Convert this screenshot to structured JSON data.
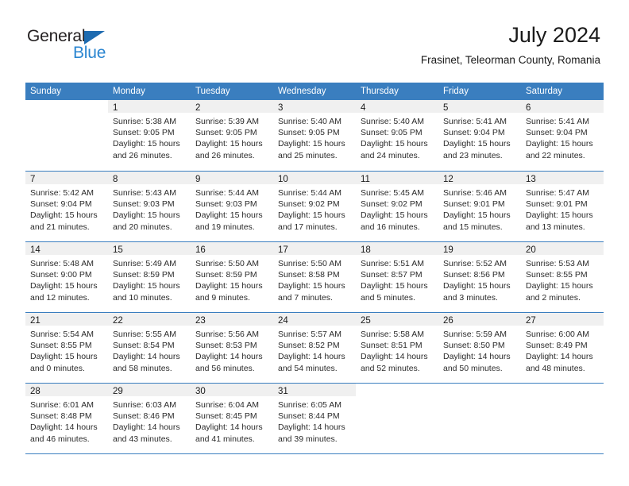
{
  "brand": {
    "name_top": "General",
    "name_bottom": "Blue",
    "triangle_color": "#1e6bb0",
    "blue_color": "#2a85d0"
  },
  "header": {
    "title": "July 2024",
    "subtitle": "Frasinet, Teleorman County, Romania"
  },
  "theme": {
    "header_blue": "#3a7ebf",
    "day_band_gray": "#f0f0f0",
    "text": "#1a1a1a"
  },
  "calendar": {
    "weekday_headers": [
      "Sunday",
      "Monday",
      "Tuesday",
      "Wednesday",
      "Thursday",
      "Friday",
      "Saturday"
    ],
    "weeks": [
      [
        {
          "day": "",
          "empty": true,
          "sunrise": "",
          "sunset": "",
          "daylight_1": "",
          "daylight_2": ""
        },
        {
          "day": "1",
          "sunrise": "Sunrise: 5:38 AM",
          "sunset": "Sunset: 9:05 PM",
          "daylight_1": "Daylight: 15 hours",
          "daylight_2": "and 26 minutes."
        },
        {
          "day": "2",
          "sunrise": "Sunrise: 5:39 AM",
          "sunset": "Sunset: 9:05 PM",
          "daylight_1": "Daylight: 15 hours",
          "daylight_2": "and 26 minutes."
        },
        {
          "day": "3",
          "sunrise": "Sunrise: 5:40 AM",
          "sunset": "Sunset: 9:05 PM",
          "daylight_1": "Daylight: 15 hours",
          "daylight_2": "and 25 minutes."
        },
        {
          "day": "4",
          "sunrise": "Sunrise: 5:40 AM",
          "sunset": "Sunset: 9:05 PM",
          "daylight_1": "Daylight: 15 hours",
          "daylight_2": "and 24 minutes."
        },
        {
          "day": "5",
          "sunrise": "Sunrise: 5:41 AM",
          "sunset": "Sunset: 9:04 PM",
          "daylight_1": "Daylight: 15 hours",
          "daylight_2": "and 23 minutes."
        },
        {
          "day": "6",
          "sunrise": "Sunrise: 5:41 AM",
          "sunset": "Sunset: 9:04 PM",
          "daylight_1": "Daylight: 15 hours",
          "daylight_2": "and 22 minutes."
        }
      ],
      [
        {
          "day": "7",
          "sunrise": "Sunrise: 5:42 AM",
          "sunset": "Sunset: 9:04 PM",
          "daylight_1": "Daylight: 15 hours",
          "daylight_2": "and 21 minutes."
        },
        {
          "day": "8",
          "sunrise": "Sunrise: 5:43 AM",
          "sunset": "Sunset: 9:03 PM",
          "daylight_1": "Daylight: 15 hours",
          "daylight_2": "and 20 minutes."
        },
        {
          "day": "9",
          "sunrise": "Sunrise: 5:44 AM",
          "sunset": "Sunset: 9:03 PM",
          "daylight_1": "Daylight: 15 hours",
          "daylight_2": "and 19 minutes."
        },
        {
          "day": "10",
          "sunrise": "Sunrise: 5:44 AM",
          "sunset": "Sunset: 9:02 PM",
          "daylight_1": "Daylight: 15 hours",
          "daylight_2": "and 17 minutes."
        },
        {
          "day": "11",
          "sunrise": "Sunrise: 5:45 AM",
          "sunset": "Sunset: 9:02 PM",
          "daylight_1": "Daylight: 15 hours",
          "daylight_2": "and 16 minutes."
        },
        {
          "day": "12",
          "sunrise": "Sunrise: 5:46 AM",
          "sunset": "Sunset: 9:01 PM",
          "daylight_1": "Daylight: 15 hours",
          "daylight_2": "and 15 minutes."
        },
        {
          "day": "13",
          "sunrise": "Sunrise: 5:47 AM",
          "sunset": "Sunset: 9:01 PM",
          "daylight_1": "Daylight: 15 hours",
          "daylight_2": "and 13 minutes."
        }
      ],
      [
        {
          "day": "14",
          "sunrise": "Sunrise: 5:48 AM",
          "sunset": "Sunset: 9:00 PM",
          "daylight_1": "Daylight: 15 hours",
          "daylight_2": "and 12 minutes."
        },
        {
          "day": "15",
          "sunrise": "Sunrise: 5:49 AM",
          "sunset": "Sunset: 8:59 PM",
          "daylight_1": "Daylight: 15 hours",
          "daylight_2": "and 10 minutes."
        },
        {
          "day": "16",
          "sunrise": "Sunrise: 5:50 AM",
          "sunset": "Sunset: 8:59 PM",
          "daylight_1": "Daylight: 15 hours",
          "daylight_2": "and 9 minutes."
        },
        {
          "day": "17",
          "sunrise": "Sunrise: 5:50 AM",
          "sunset": "Sunset: 8:58 PM",
          "daylight_1": "Daylight: 15 hours",
          "daylight_2": "and 7 minutes."
        },
        {
          "day": "18",
          "sunrise": "Sunrise: 5:51 AM",
          "sunset": "Sunset: 8:57 PM",
          "daylight_1": "Daylight: 15 hours",
          "daylight_2": "and 5 minutes."
        },
        {
          "day": "19",
          "sunrise": "Sunrise: 5:52 AM",
          "sunset": "Sunset: 8:56 PM",
          "daylight_1": "Daylight: 15 hours",
          "daylight_2": "and 3 minutes."
        },
        {
          "day": "20",
          "sunrise": "Sunrise: 5:53 AM",
          "sunset": "Sunset: 8:55 PM",
          "daylight_1": "Daylight: 15 hours",
          "daylight_2": "and 2 minutes."
        }
      ],
      [
        {
          "day": "21",
          "sunrise": "Sunrise: 5:54 AM",
          "sunset": "Sunset: 8:55 PM",
          "daylight_1": "Daylight: 15 hours",
          "daylight_2": "and 0 minutes."
        },
        {
          "day": "22",
          "sunrise": "Sunrise: 5:55 AM",
          "sunset": "Sunset: 8:54 PM",
          "daylight_1": "Daylight: 14 hours",
          "daylight_2": "and 58 minutes."
        },
        {
          "day": "23",
          "sunrise": "Sunrise: 5:56 AM",
          "sunset": "Sunset: 8:53 PM",
          "daylight_1": "Daylight: 14 hours",
          "daylight_2": "and 56 minutes."
        },
        {
          "day": "24",
          "sunrise": "Sunrise: 5:57 AM",
          "sunset": "Sunset: 8:52 PM",
          "daylight_1": "Daylight: 14 hours",
          "daylight_2": "and 54 minutes."
        },
        {
          "day": "25",
          "sunrise": "Sunrise: 5:58 AM",
          "sunset": "Sunset: 8:51 PM",
          "daylight_1": "Daylight: 14 hours",
          "daylight_2": "and 52 minutes."
        },
        {
          "day": "26",
          "sunrise": "Sunrise: 5:59 AM",
          "sunset": "Sunset: 8:50 PM",
          "daylight_1": "Daylight: 14 hours",
          "daylight_2": "and 50 minutes."
        },
        {
          "day": "27",
          "sunrise": "Sunrise: 6:00 AM",
          "sunset": "Sunset: 8:49 PM",
          "daylight_1": "Daylight: 14 hours",
          "daylight_2": "and 48 minutes."
        }
      ],
      [
        {
          "day": "28",
          "sunrise": "Sunrise: 6:01 AM",
          "sunset": "Sunset: 8:48 PM",
          "daylight_1": "Daylight: 14 hours",
          "daylight_2": "and 46 minutes."
        },
        {
          "day": "29",
          "sunrise": "Sunrise: 6:03 AM",
          "sunset": "Sunset: 8:46 PM",
          "daylight_1": "Daylight: 14 hours",
          "daylight_2": "and 43 minutes."
        },
        {
          "day": "30",
          "sunrise": "Sunrise: 6:04 AM",
          "sunset": "Sunset: 8:45 PM",
          "daylight_1": "Daylight: 14 hours",
          "daylight_2": "and 41 minutes."
        },
        {
          "day": "31",
          "sunrise": "Sunrise: 6:05 AM",
          "sunset": "Sunset: 8:44 PM",
          "daylight_1": "Daylight: 14 hours",
          "daylight_2": "and 39 minutes."
        },
        {
          "day": "",
          "empty": true,
          "sunrise": "",
          "sunset": "",
          "daylight_1": "",
          "daylight_2": ""
        },
        {
          "day": "",
          "empty": true,
          "sunrise": "",
          "sunset": "",
          "daylight_1": "",
          "daylight_2": ""
        },
        {
          "day": "",
          "empty": true,
          "sunrise": "",
          "sunset": "",
          "daylight_1": "",
          "daylight_2": ""
        }
      ]
    ]
  }
}
